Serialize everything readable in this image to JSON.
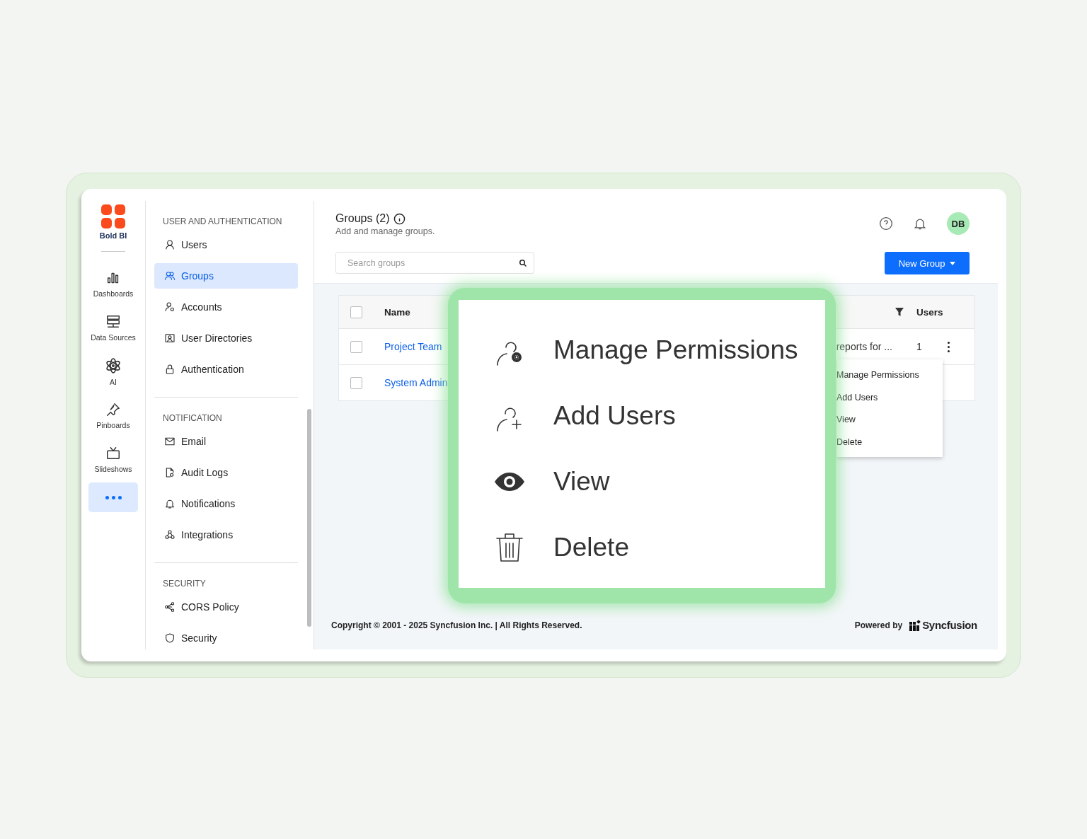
{
  "brand": {
    "name": "Bold BI"
  },
  "rail": [
    {
      "label": "Dashboards",
      "kind": "dashboards",
      "selected": false
    },
    {
      "label": "Data Sources",
      "kind": "datasources",
      "selected": false
    },
    {
      "label": "AI",
      "kind": "ai",
      "selected": false
    },
    {
      "label": "Pinboards",
      "kind": "pinboards",
      "selected": false
    },
    {
      "label": "Slideshows",
      "kind": "slideshows",
      "selected": false
    }
  ],
  "more_button": {
    "selected": true
  },
  "nav": [
    {
      "title": "USER AND AUTHENTICATION",
      "items": [
        {
          "label": "Users",
          "kind": "user",
          "selected": false
        },
        {
          "label": "Groups",
          "kind": "group",
          "selected": true
        },
        {
          "label": "Accounts",
          "kind": "account",
          "selected": false
        },
        {
          "label": "User Directories",
          "kind": "directory",
          "selected": false
        },
        {
          "label": "Authentication",
          "kind": "lock",
          "selected": false
        }
      ]
    },
    {
      "title": "NOTIFICATION",
      "items": [
        {
          "label": "Email",
          "kind": "mail",
          "selected": false
        },
        {
          "label": "Audit Logs",
          "kind": "log",
          "selected": false
        },
        {
          "label": "Notifications",
          "kind": "bell",
          "selected": false
        },
        {
          "label": "Integrations",
          "kind": "integration",
          "selected": false
        }
      ]
    },
    {
      "title": "SECURITY",
      "items": [
        {
          "label": "CORS Policy",
          "kind": "share",
          "selected": false
        },
        {
          "label": "Security",
          "kind": "shield",
          "selected": false
        }
      ]
    }
  ],
  "header": {
    "title": "Groups (2)",
    "subtitle": "Add and manage groups.",
    "search": {
      "placeholder": "Search groups"
    },
    "new_button": "New Group",
    "avatar": "DB"
  },
  "table": {
    "columns": [
      {
        "label": "Name"
      },
      {
        "label": "Users"
      }
    ],
    "header_checked": false,
    "rows": [
      {
        "name": "Project Team",
        "description": "reports for ...",
        "users": "1",
        "checked": false
      },
      {
        "name": "System Admin",
        "checked": false
      }
    ]
  },
  "context_menu": [
    "Manage Permissions",
    "Add Users",
    "View",
    "Delete"
  ],
  "callout": [
    {
      "label": "Manage Permissions",
      "kind": "permissions"
    },
    {
      "label": "Add Users",
      "kind": "add-user"
    },
    {
      "label": "View",
      "kind": "view"
    },
    {
      "label": "Delete",
      "kind": "delete"
    }
  ],
  "footer": {
    "copyright": "Copyright © 2001 - 2025 Syncfusion Inc. | All Rights Reserved.",
    "powered_by": "Powered by",
    "brand": "Syncfusion"
  }
}
